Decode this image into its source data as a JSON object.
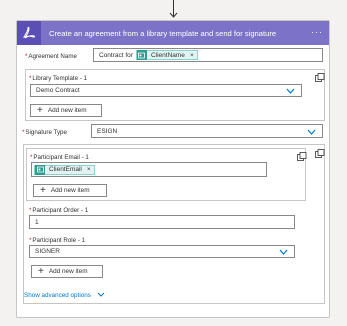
{
  "header": {
    "title": "Create an agreement from a library template and send for signature",
    "more": "···",
    "color": "#7c73c8"
  },
  "agreement_name": {
    "label": "Agreement Name",
    "prefix": "Contract for",
    "token": "ClientName"
  },
  "library_template": {
    "label": "Library Template - 1",
    "value": "Demo Contract",
    "add": "Add new item"
  },
  "signature_type": {
    "label": "Signature Type",
    "value": "ESIGN"
  },
  "participant_email": {
    "label": "Participant Email - 1",
    "token": "ClientEmail",
    "add": "Add new item"
  },
  "participant_order": {
    "label": "Participant Order - 1",
    "value": "1"
  },
  "participant_role": {
    "label": "Participant Role - 1",
    "value": "SIGNER",
    "add": "Add new item"
  },
  "advanced": {
    "label": "Show advanced options"
  },
  "token_x": "×"
}
